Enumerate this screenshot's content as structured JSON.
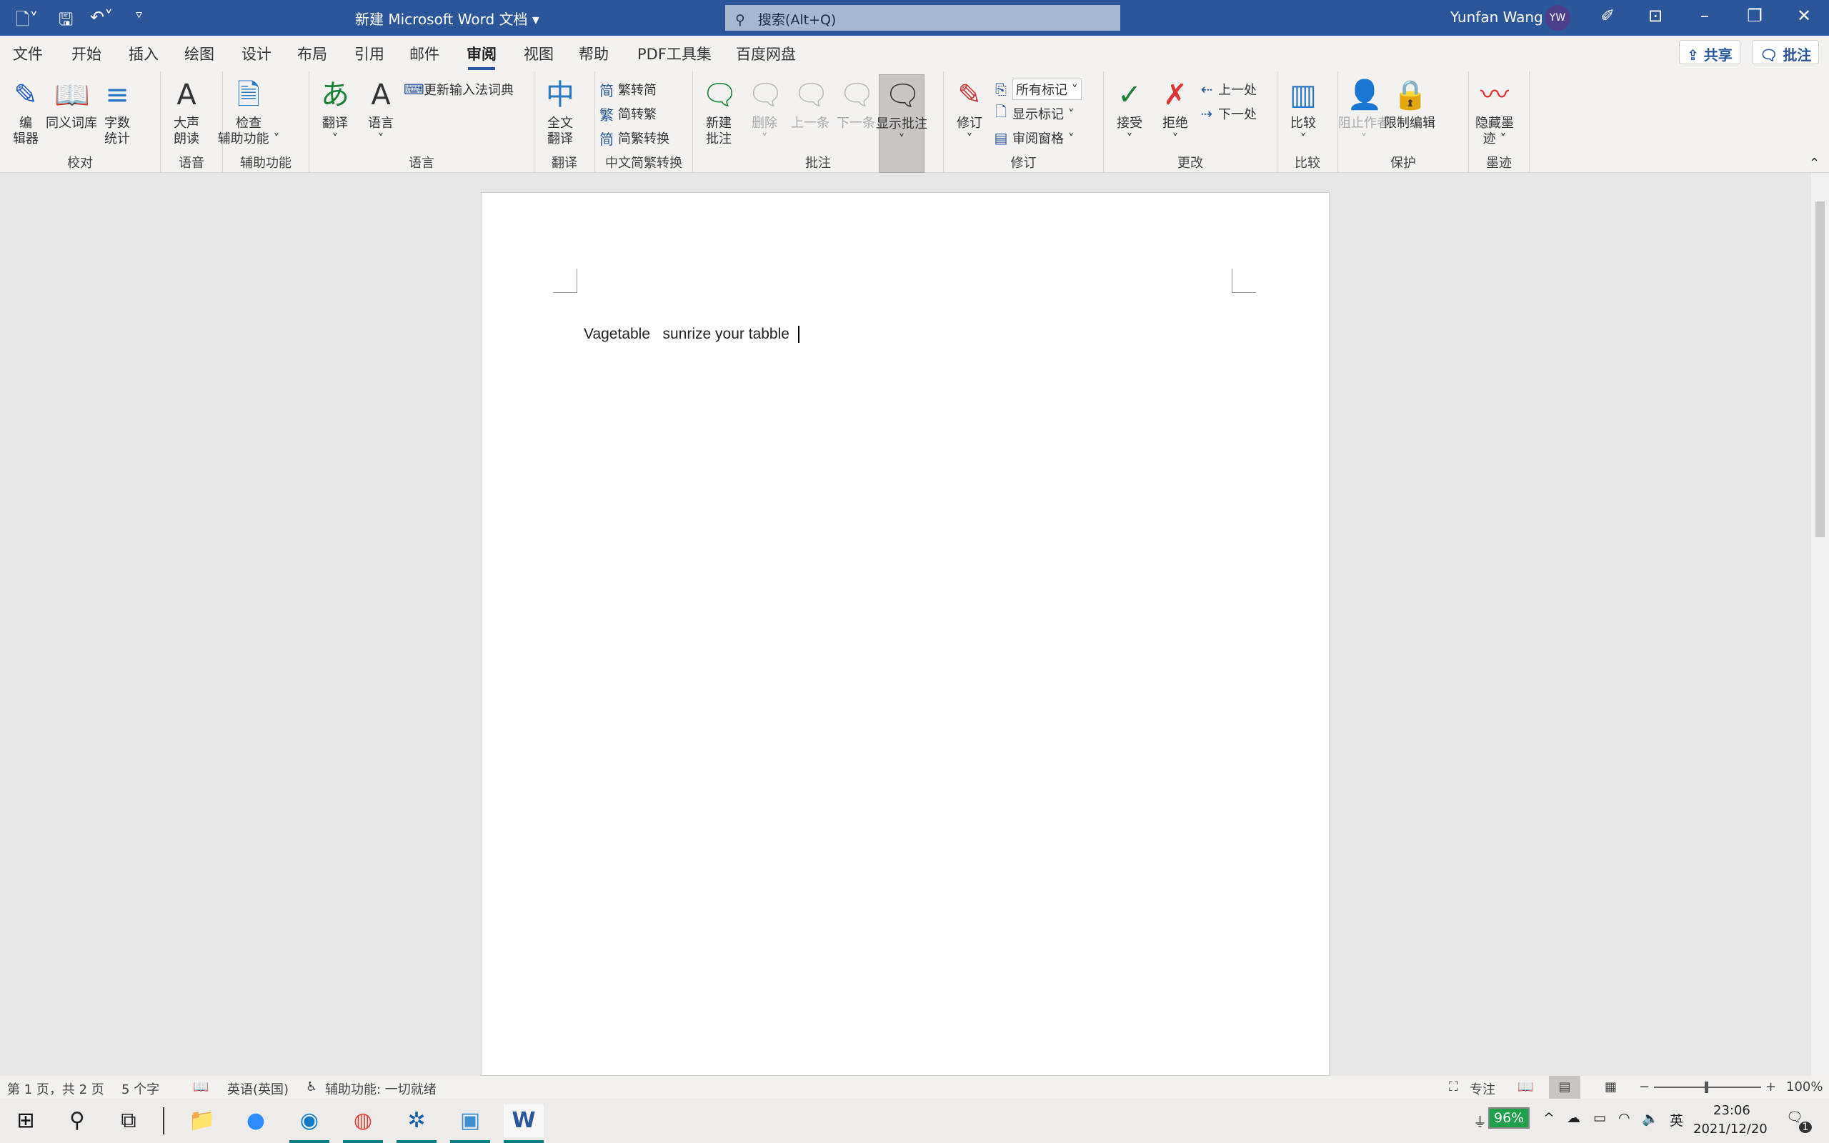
{
  "titlebar": {
    "quick_access": [
      "document-icon",
      "save-icon",
      "undo-icon",
      "customize-icon"
    ],
    "title": "新建 Microsoft Word 文档",
    "search_placeholder": "搜索(Alt+Q)",
    "user": "Yunfan Wang",
    "avatar": "YW",
    "color": "#2b579a"
  },
  "tabs": [
    "文件",
    "开始",
    "插入",
    "绘图",
    "设计",
    "布局",
    "引用",
    "邮件",
    "审阅",
    "视图",
    "帮助",
    "PDF工具集",
    "百度网盘"
  ],
  "active_tab": "审阅",
  "share_label": "共享",
  "comment_label": "批注",
  "ribbon": [
    {
      "label": "校对",
      "large": [
        {
          "label": "编\n辑器",
          "icon": "✎",
          "color": "#1e5bc6"
        },
        {
          "label": "同义词库",
          "icon": "📖",
          "color": "#333"
        },
        {
          "label": "字数\n统计",
          "icon": "≡",
          "color": "#2b79c2"
        }
      ]
    },
    {
      "label": "语音",
      "large": [
        {
          "label": "大声\n朗读",
          "icon": "A",
          "color": "#333"
        }
      ]
    },
    {
      "label": "辅助功能",
      "large": [
        {
          "label": "检查\n辅助功能 ˅",
          "icon": "🗎",
          "color": "#2b79c2"
        }
      ]
    },
    {
      "label": "语言",
      "large": [
        {
          "label": "翻译\n˅",
          "icon": "あ",
          "color": "#1a7f37"
        },
        {
          "label": "语言\n˅",
          "icon": "A",
          "color": "#333"
        }
      ],
      "small": [
        {
          "label": "更新输入法词典",
          "icon": "⌨"
        }
      ]
    },
    {
      "label": "翻译",
      "large": [
        {
          "label": "全文\n翻译",
          "icon": "中",
          "color": "#2b79c2"
        }
      ]
    },
    {
      "label": "中文简繁转换",
      "small": [
        {
          "label": "繁转简",
          "icon": "简"
        },
        {
          "label": "简转繁",
          "icon": "繁"
        },
        {
          "label": "简繁转换",
          "icon": "简"
        }
      ]
    },
    {
      "label": "批注",
      "large": [
        {
          "label": "新建\n批注",
          "icon": "🗨",
          "color": "#1a7f37"
        },
        {
          "label": "删除\n˅",
          "icon": "🗨",
          "disabled": true
        },
        {
          "label": "上一条",
          "icon": "🗨",
          "disabled": true
        },
        {
          "label": "下一条",
          "icon": "🗨",
          "disabled": true
        },
        {
          "label": "显示批注\n˅",
          "icon": "🗨",
          "selected": true,
          "color": "#333"
        }
      ]
    },
    {
      "label": "修订",
      "large": [
        {
          "label": "修订\n˅",
          "icon": "✎",
          "color": "#c33"
        }
      ],
      "small": [
        {
          "label": "所有标记 ˅",
          "icon": "⎘"
        },
        {
          "label": "显示标记 ˅",
          "icon": "🗋"
        },
        {
          "label": "审阅窗格 ˅",
          "icon": "▤"
        }
      ]
    },
    {
      "label": "更改",
      "large": [
        {
          "label": "接受\n˅",
          "icon": "✓",
          "color": "#1a7f37"
        },
        {
          "label": "拒绝\n˅",
          "icon": "✗",
          "color": "#d33"
        }
      ],
      "small": [
        {
          "label": "上一处",
          "icon": "⇠"
        },
        {
          "label": "下一处",
          "icon": "⇢"
        }
      ]
    },
    {
      "label": "比较",
      "large": [
        {
          "label": "比较\n˅",
          "icon": "▥",
          "color": "#2b79c2"
        }
      ]
    },
    {
      "label": "保护",
      "large": [
        {
          "label": "阻止作者\n˅",
          "icon": "👤",
          "disabled": true
        },
        {
          "label": "限制编辑",
          "icon": "🔒",
          "color": "#e39a1e"
        }
      ]
    },
    {
      "label": "墨迹",
      "large": [
        {
          "label": "隐藏墨\n迹 ˅",
          "icon": "〰",
          "color": "#d33"
        }
      ]
    }
  ],
  "document": {
    "text": "Vagetable   sunrize your tabble"
  },
  "status": {
    "page": "第 1 页，共 2 页",
    "words": "5 个字",
    "language": "英语(英国)",
    "accessibility": "辅助功能: 一切就绪",
    "focus": "专注",
    "zoom": "100%",
    "zoom_level": 100
  },
  "taskbar": {
    "apps": [
      "windows-start",
      "search",
      "task-view",
      "file-explorer",
      "zoom",
      "edge",
      "chrome",
      "app",
      "remote-desktop",
      "word"
    ],
    "battery": "96%",
    "ime": "英",
    "time": "23:06",
    "date": "2021/12/20",
    "notifications": "1"
  }
}
